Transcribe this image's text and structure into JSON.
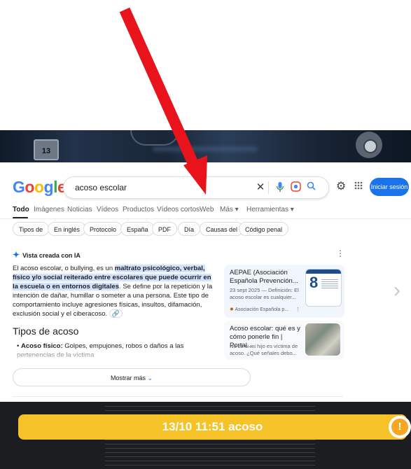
{
  "strip": {
    "calendar_day": "13"
  },
  "header": {
    "logo": {
      "G": "G",
      "o1": "o",
      "o2": "o",
      "g": "g",
      "l": "l",
      "e": "e"
    },
    "query": "acoso escolar",
    "signin_label": "Iniciar sesión"
  },
  "tabs": [
    "Todo",
    "Imágenes",
    "Noticias",
    "Vídeos",
    "Productos",
    "Vídeos cortos",
    "Web",
    "Más ▾",
    "Herramientas ▾"
  ],
  "chips": [
    "Tipos de",
    "En inglés",
    "Protocolo",
    "España",
    "PDF",
    "Día",
    "Causas del",
    "Código penal"
  ],
  "ai": {
    "heading": "Vista creada con IA",
    "p1_a": "El acoso escolar, o bullying, es un ",
    "p1_hl1": "maltrato psicológico, verbal, físico y/o social reiterado entre escolares que puede ocurrir en la escuela o en entornos digitales",
    "p1_b": ". Se define por la repetición y la intención de dañar, humillar o someter a una persona. Este tipo de comportamiento incluye agresiones físicas, insultos, difamación, exclusión social y el ciberacoso.",
    "types_title": "Tipos de acoso",
    "bullet_label": "Acoso físico:",
    "bullet_text": " Golpes, empujones, robos o daños a las pertenencias de la víctima",
    "show_more": "Mostrar más"
  },
  "cards": [
    {
      "title": "AEPAE (Asociación Española Prevención...",
      "snippet": "23 sept 2025 — Definición: El acoso escolar es cualquier...",
      "source": "Asociación Española p...",
      "thumb_num": "8"
    },
    {
      "title": "Acoso escolar: qué es y cómo ponerle fin | Portal...",
      "snippet": "No sé si mi hijo es víctima de acoso. ¿Qué señales debo..."
    }
  ],
  "banner": {
    "text": "13/10 11:51 acoso",
    "color": "#f5c227"
  },
  "colors": {
    "accent": "#1a73e8",
    "highlight": "#d3e3fd",
    "arrow": "#e8131b"
  }
}
